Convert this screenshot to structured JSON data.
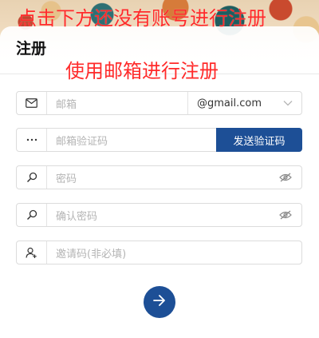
{
  "annotations": {
    "top_note": "点击下方还没有账号进行注册",
    "mid_note": "使用邮箱进行注册"
  },
  "page": {
    "title": "注册"
  },
  "form": {
    "email_placeholder": "邮箱",
    "email_domain": "@gmail.com",
    "code_placeholder": "邮箱验证码",
    "send_code_label": "发送验证码",
    "password_placeholder": "密码",
    "confirm_password_placeholder": "确认密码",
    "invite_placeholder": "邀请码(非必填)"
  },
  "icons": {
    "email": "envelope-icon",
    "code": "dots-icon",
    "password": "key-search-icon",
    "confirm": "key-search-icon",
    "invite": "user-plus-icon",
    "visibility": "eye-off-icon",
    "dropdown": "chevron-down-icon",
    "submit": "arrow-right-icon"
  },
  "colors": {
    "primary": "#1d4f96",
    "annotation": "#ff2a2a",
    "border": "#dcdcdc",
    "placeholder": "#b4b4b4"
  }
}
